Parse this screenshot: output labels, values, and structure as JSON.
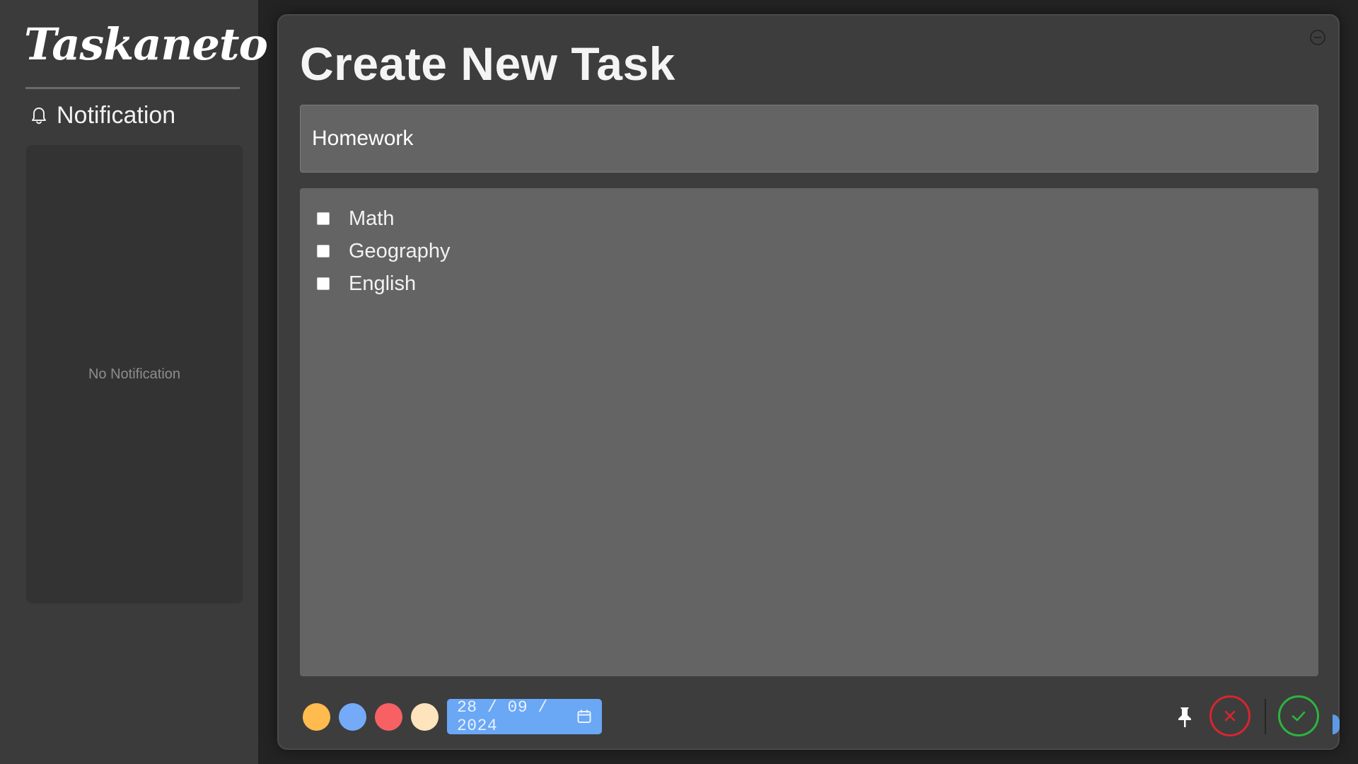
{
  "app": {
    "logo_text": "Taskaneto"
  },
  "sidebar": {
    "notification_title": "Notification",
    "notification_empty": "No Notification"
  },
  "modal": {
    "title": "Create New Task",
    "task_title_value": "Homework",
    "items": [
      {
        "label": "Math",
        "checked": false
      },
      {
        "label": "Geography",
        "checked": false
      },
      {
        "label": "English",
        "checked": false
      }
    ],
    "colors": [
      "#ffbb4d",
      "#74aaf8",
      "#f76163",
      "#fde4bc"
    ],
    "due_date": "28 / 09 / 2024"
  },
  "icons": {
    "bell": "bell-icon",
    "minimize": "minus-circle-icon",
    "calendar": "calendar-icon",
    "pin": "pin-icon",
    "cancel": "close-icon",
    "confirm": "check-icon"
  },
  "colors": {
    "background": "#232323",
    "sidebar": "#3b3b3b",
    "modal": "#3d3d3d",
    "field": "#646464",
    "accent_date": "#6aa7f5",
    "cancel": "#d8252f",
    "confirm": "#2db43f"
  }
}
